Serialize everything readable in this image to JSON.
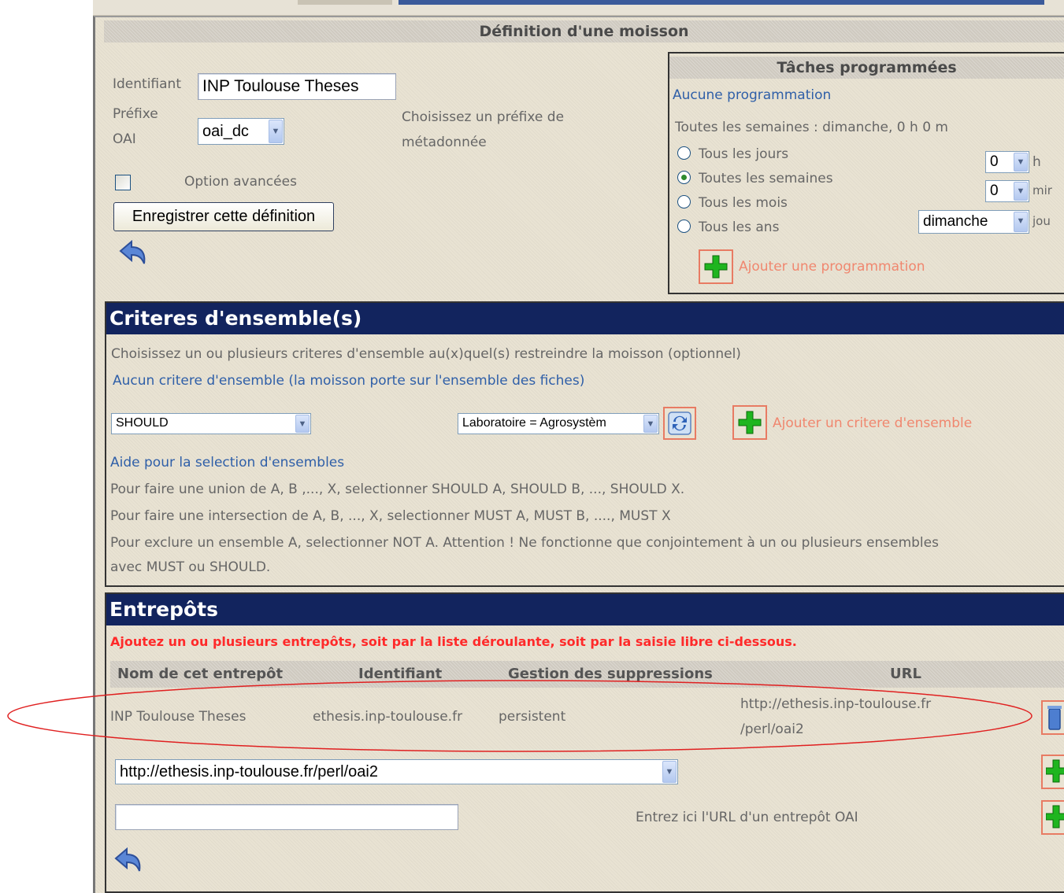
{
  "title": "Définition d'une moisson",
  "form": {
    "identifier_label": "Identifiant",
    "identifier_value": "INP Toulouse Theses",
    "prefix_label_line1": "Préfixe",
    "prefix_label_line2": "OAI",
    "prefix_value": "oai_dc",
    "prefix_help_line1": "Choisissez un préfixe de",
    "prefix_help_line2": "métadonnée",
    "advanced_label": "Option avancées",
    "save_button": "Enregistrer cette définition"
  },
  "schedule": {
    "title": "Tâches programmées",
    "none_link": "Aucune programmation",
    "summary": "Toutes les semaines : dimanche, 0 h 0 m",
    "options": [
      {
        "label": "Tous les jours",
        "checked": false
      },
      {
        "label": "Toutes les semaines",
        "checked": true
      },
      {
        "label": "Tous les mois",
        "checked": false
      },
      {
        "label": "Tous les ans",
        "checked": false
      }
    ],
    "hour_value": "0",
    "hour_suffix": "h",
    "minute_value": "0",
    "minute_suffix": "mir",
    "day_value": "dimanche",
    "day_suffix": "jou",
    "add_label": "Ajouter une programmation"
  },
  "criteria": {
    "header": "Criteres d'ensemble(s)",
    "instruction": "Choisissez un ou plusieurs criteres d'ensemble au(x)quel(s) restreindre la moisson (optionnel)",
    "none_link": "Aucun critere d'ensemble (la moisson porte sur l'ensemble des fiches)",
    "operator_value": "SHOULD",
    "set_value": "Laboratoire = Agrosystèm",
    "add_label": "Ajouter un critere d'ensemble",
    "help_link": "Aide pour la selection d'ensembles",
    "help_lines": [
      "Pour faire une union de A, B ,..., X, selectionner SHOULD A, SHOULD B, ..., SHOULD X.",
      "Pour faire une intersection de A, B, ..., X, selectionner MUST A, MUST B, ...., MUST X",
      "Pour exclure un ensemble A, selectionner NOT A. Attention ! Ne fonctionne que conjointement à un ou plusieurs ensembles",
      "avec MUST ou SHOULD."
    ]
  },
  "repos": {
    "header": "Entrepôts",
    "instruction": "Ajoutez un ou plusieurs entrepôts, soit par la liste déroulante, soit par la saisie libre ci-dessous.",
    "columns": [
      "Nom de cet entrepôt",
      "Identifiant",
      "Gestion des suppressions",
      "URL"
    ],
    "row": {
      "name": "INP Toulouse Theses",
      "identifier": "ethesis.inp-toulouse.fr",
      "deletion": "persistent",
      "url_line1": "http://ethesis.inp-toulouse.fr",
      "url_line2": "/perl/oai2"
    },
    "select_value": "http://ethesis.inp-toulouse.fr/perl/oai2",
    "free_input_value": "",
    "free_input_help": "Entrez ici l'URL d'un entrepôt OAI"
  },
  "colors": {
    "header_bg": "#12245e",
    "link": "#2f5fa8",
    "action_orange": "#f0876f",
    "warning_red": "#ff2a2a",
    "highlight_oval": "#e02020"
  }
}
